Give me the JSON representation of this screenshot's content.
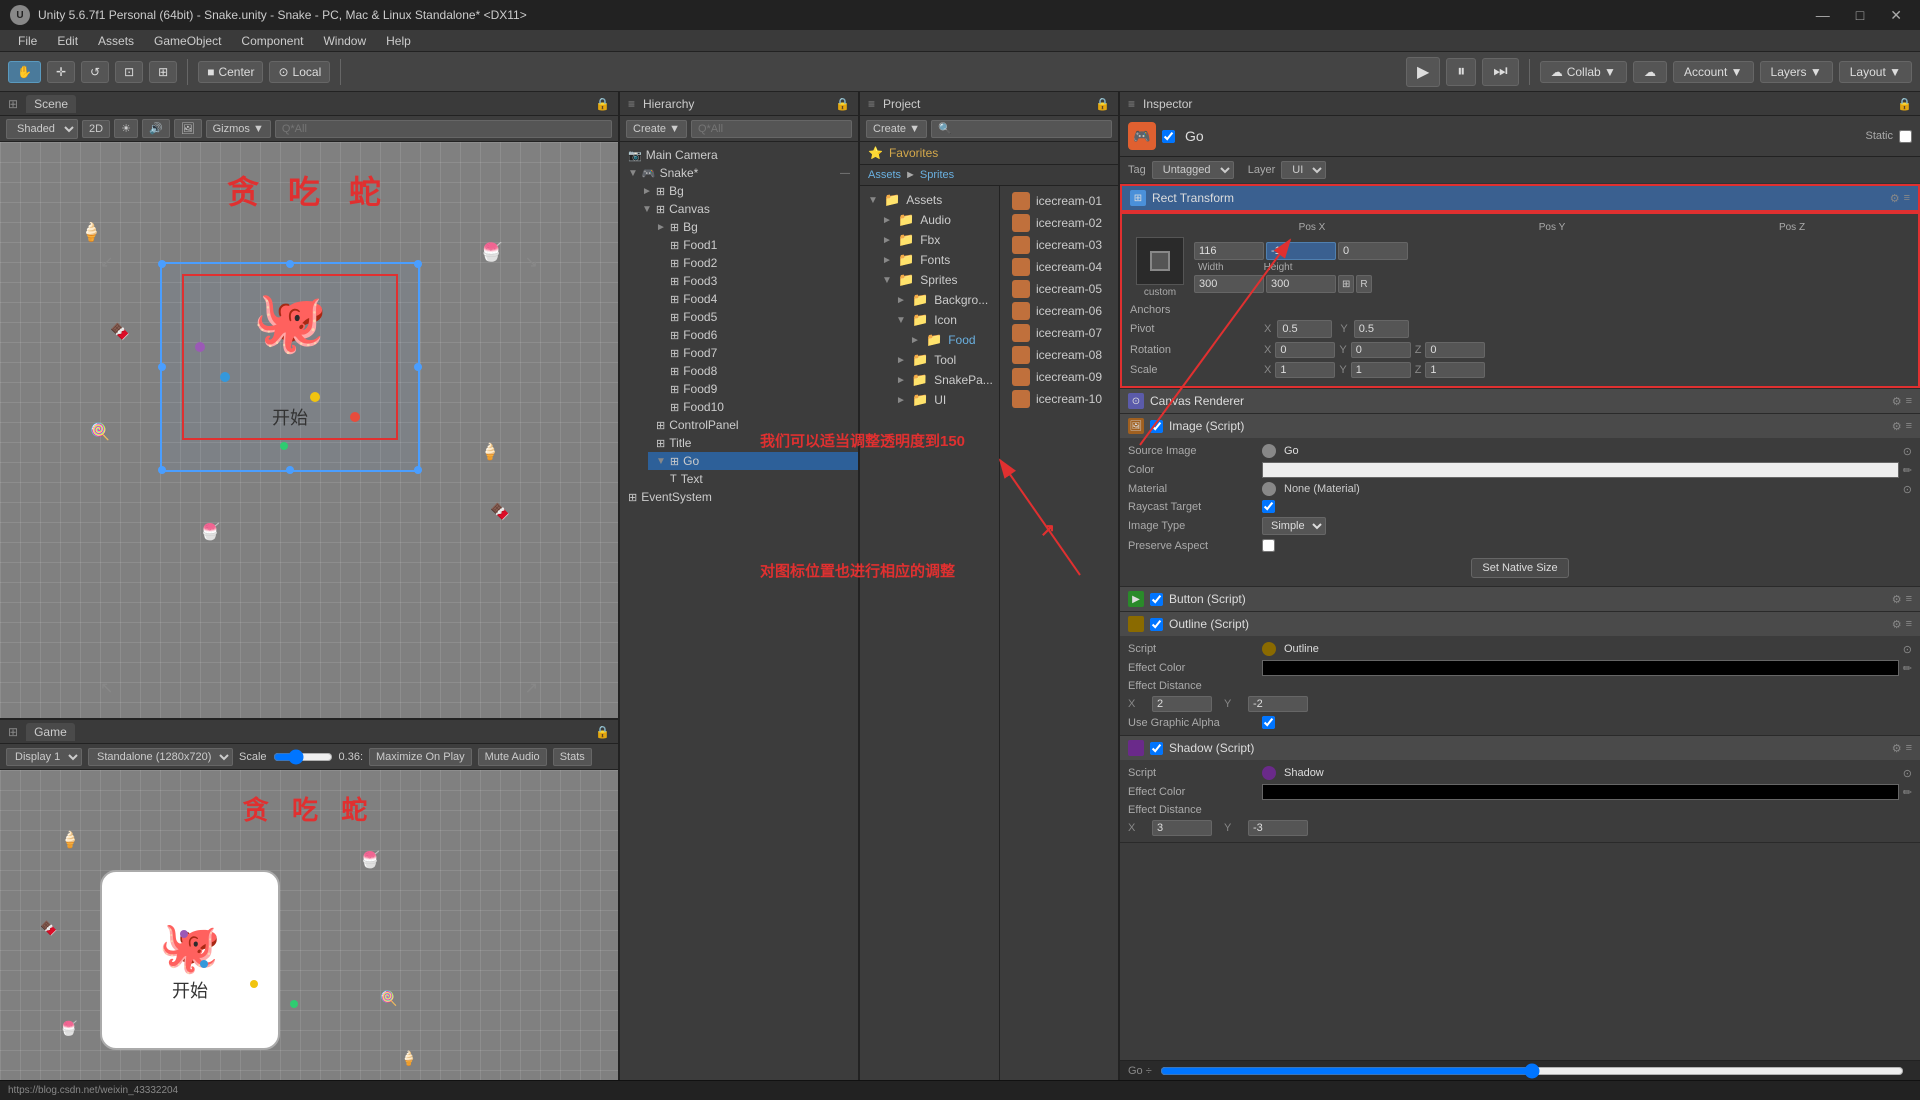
{
  "titleBar": {
    "title": "Unity 5.6.7f1 Personal (64bit) - Snake.unity - Snake - PC, Mac & Linux Standalone* <DX11>",
    "winControls": [
      "—",
      "□",
      "✕"
    ]
  },
  "menuBar": {
    "items": [
      "File",
      "Edit",
      "Assets",
      "GameObject",
      "Component",
      "Window",
      "Help"
    ]
  },
  "toolbar": {
    "tools": [
      "✋",
      "✛",
      "↺",
      "⊡",
      "⊞"
    ],
    "center": "Center",
    "local": "Local",
    "play": "▶",
    "pause": "⏸",
    "stepForward": "⏭",
    "collab": "Collab ▼",
    "account": "Account ▼",
    "layers": "Layers ▼",
    "layout": "Layout ▼"
  },
  "scenePanel": {
    "tab": "Scene",
    "shading": "Shaded",
    "is2D": "2D",
    "gizmos": "Gizmos ▼",
    "searchPlaceholder": "Q*All"
  },
  "gamePanel": {
    "tab": "Game",
    "display": "Display 1",
    "resolution": "Standalone (1280x720)",
    "scale": "Scale",
    "scaleValue": "0.36:",
    "maximizeOnPlay": "Maximize On Play",
    "muteAudio": "Mute Audio",
    "stats": "Stats"
  },
  "hierarchyPanel": {
    "tab": "Hierarchy",
    "createBtn": "Create ▼",
    "searchPlaceholder": "Q*All",
    "items": [
      {
        "id": "snake",
        "label": "Snake*",
        "level": 0,
        "arrow": "▼",
        "icon": "⊞"
      },
      {
        "id": "bg",
        "label": "Bg",
        "level": 1,
        "arrow": "►",
        "icon": "⊞"
      },
      {
        "id": "canvas",
        "label": "Canvas",
        "level": 1,
        "arrow": "▼",
        "icon": "⊞"
      },
      {
        "id": "bg2",
        "label": "Bg",
        "level": 2,
        "arrow": "",
        "icon": "⊞"
      },
      {
        "id": "food1",
        "label": "Food1",
        "level": 3,
        "arrow": "",
        "icon": "⊞"
      },
      {
        "id": "food2",
        "label": "Food2",
        "level": 3,
        "arrow": "",
        "icon": "⊞"
      },
      {
        "id": "food3",
        "label": "Food3",
        "level": 3,
        "arrow": "",
        "icon": "⊞"
      },
      {
        "id": "food4",
        "label": "Food4",
        "level": 3,
        "arrow": "",
        "icon": "⊞"
      },
      {
        "id": "food5",
        "label": "Food5",
        "level": 3,
        "arrow": "",
        "icon": "⊞"
      },
      {
        "id": "food6",
        "label": "Food6",
        "level": 3,
        "arrow": "",
        "icon": "⊞"
      },
      {
        "id": "food7",
        "label": "Food7",
        "level": 3,
        "arrow": "",
        "icon": "⊞"
      },
      {
        "id": "food8",
        "label": "Food8",
        "level": 3,
        "arrow": "",
        "icon": "⊞"
      },
      {
        "id": "food9",
        "label": "Food9",
        "level": 3,
        "arrow": "",
        "icon": "⊞"
      },
      {
        "id": "food10",
        "label": "Food10",
        "level": 3,
        "arrow": "",
        "icon": "⊞"
      },
      {
        "id": "controlPanel",
        "label": "ControlPanel",
        "level": 2,
        "arrow": "",
        "icon": "⊞"
      },
      {
        "id": "title",
        "label": "Title",
        "level": 2,
        "arrow": "",
        "icon": "⊞"
      },
      {
        "id": "go",
        "label": "Go",
        "level": 2,
        "arrow": "▼",
        "icon": "⊞",
        "selected": true
      },
      {
        "id": "text",
        "label": "Text",
        "level": 3,
        "arrow": "",
        "icon": "⊞"
      },
      {
        "id": "mainCamera",
        "label": "Main Camera",
        "level": 0,
        "arrow": "",
        "icon": "📷"
      },
      {
        "id": "eventSystem",
        "label": "EventSystem",
        "level": 0,
        "arrow": "",
        "icon": "⊞"
      }
    ]
  },
  "projectPanel": {
    "tab": "Project",
    "createBtn": "Create ▼",
    "searchPlaceholder": "🔍",
    "breadcrumb": [
      "Assets",
      "Sprites"
    ],
    "favorites": "Favorites",
    "assets": {
      "label": "Assets",
      "children": [
        {
          "label": "Audio",
          "type": "folder"
        },
        {
          "label": "Fbx",
          "type": "folder"
        },
        {
          "label": "Fonts",
          "type": "folder"
        },
        {
          "label": "Sprites",
          "type": "folder",
          "expanded": true,
          "children": [
            {
              "label": "Backgro...",
              "type": "folder"
            },
            {
              "label": "Icon",
              "type": "folder",
              "expanded": true,
              "children": [
                {
                  "label": "Food",
                  "type": "folder",
                  "selected": true
                }
              ]
            },
            {
              "label": "Tool",
              "type": "folder"
            },
            {
              "label": "SnakePa...",
              "type": "folder"
            },
            {
              "label": "UI",
              "type": "folder"
            }
          ]
        }
      ]
    },
    "spritesList": [
      "icecream-01",
      "icecream-02",
      "icecream-03",
      "icecream-04",
      "icecream-05",
      "icecream-06",
      "icecream-07",
      "icecream-08",
      "icecream-09",
      "icecream-10"
    ]
  },
  "inspectorPanel": {
    "tab": "Inspector",
    "objectName": "Go",
    "isActive": true,
    "isStatic": false,
    "tag": "Untagged",
    "layer": "UI",
    "rectTransform": {
      "title": "Rect Transform",
      "custom": "custom",
      "posX": "116",
      "posY": "-15",
      "posZ": "0",
      "width": "300",
      "height": "300",
      "anchors": "Anchors",
      "pivotLabel": "Pivot",
      "pivotX": "0.5",
      "pivotY": "0.5",
      "rotationLabel": "Rotation",
      "rotX": "0",
      "rotY": "0",
      "rotZ": "0",
      "scaleLabel": "Scale",
      "scaleX": "1",
      "scaleY": "1",
      "scaleZ": "1"
    },
    "canvasRenderer": {
      "title": "Canvas Renderer"
    },
    "imageScript": {
      "title": "Image (Script)",
      "sourceImage": "Go",
      "colorLabel": "Color",
      "material": "None (Material)",
      "raycastTarget": true,
      "imageType": "Simple",
      "preserveAspect": false
    },
    "buttonScript": {
      "title": "Button (Script)"
    },
    "outlineScript": {
      "title": "Outline (Script)",
      "script": "Outline",
      "effectColorLabel": "Effect Color",
      "effectDistanceLabel": "Effect Distance",
      "distX": "2",
      "distY": "-2",
      "useGraphicAlpha": true
    },
    "shadowScript": {
      "title": "Shadow (Script)",
      "script": "Shadow",
      "effectColorLabel": "Effect Color",
      "effectDistanceLabel": "Effect Distance",
      "distX": "3",
      "distY": "-3"
    }
  },
  "annotations": {
    "text1": "我们可以适当调整透明度到150",
    "text2": "对图标位置也进行相应的调整",
    "arrow1": "→",
    "arrow2": "→"
  },
  "statusBar": {
    "url": "https://blog.csdn.net/weixin_43332204",
    "goLabel": "Go ÷"
  }
}
